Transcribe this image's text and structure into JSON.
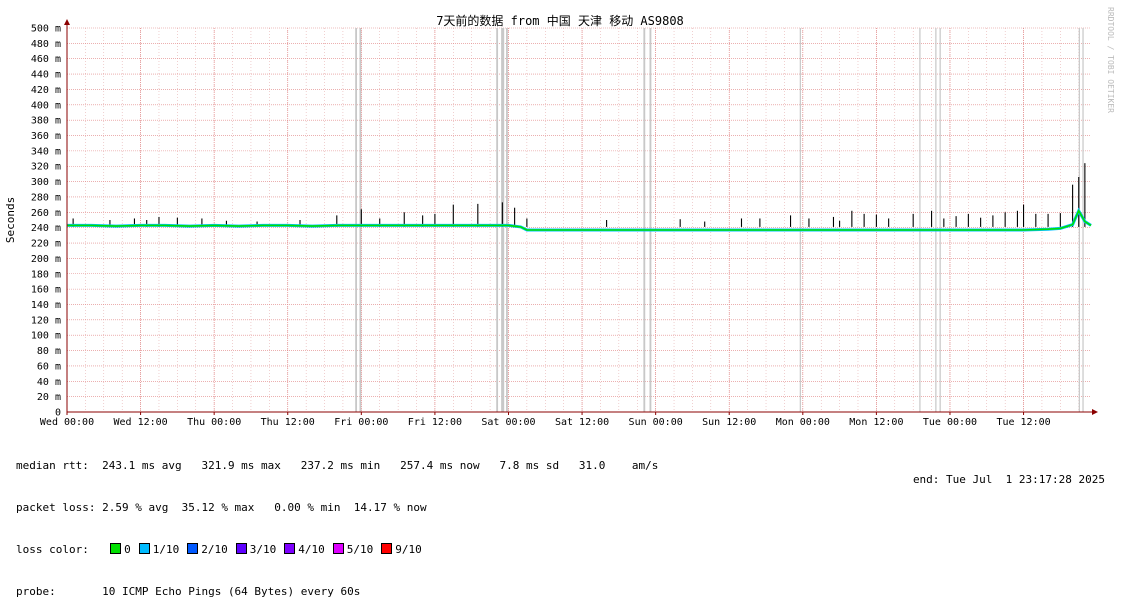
{
  "chart_data": {
    "type": "line",
    "title": "7天前的数据 from 中国 天津 移动 AS9808",
    "ylabel": "Seconds",
    "watermark": "RRDTOOL / TOBI OETIKER",
    "y_ticks": [
      "0",
      "20 m",
      "40 m",
      "60 m",
      "80 m",
      "100 m",
      "120 m",
      "140 m",
      "160 m",
      "180 m",
      "200 m",
      "220 m",
      "240 m",
      "260 m",
      "280 m",
      "300 m",
      "320 m",
      "340 m",
      "360 m",
      "380 m",
      "400 m",
      "420 m",
      "440 m",
      "460 m",
      "480 m",
      "500 m"
    ],
    "ylim_ms": [
      0,
      500
    ],
    "x_ticks": [
      "Wed 00:00",
      "Wed 12:00",
      "Thu 00:00",
      "Thu 12:00",
      "Fri 00:00",
      "Fri 12:00",
      "Sat 00:00",
      "Sat 12:00",
      "Sun 00:00",
      "Sun 12:00",
      "Mon 00:00",
      "Mon 12:00",
      "Tue 00:00",
      "Tue 12:00"
    ],
    "x_range_hours": [
      0,
      167
    ],
    "grid": true,
    "median_rtt_ms": [
      [
        0,
        243
      ],
      [
        4,
        243
      ],
      [
        8,
        242
      ],
      [
        12,
        243
      ],
      [
        16,
        243
      ],
      [
        20,
        242
      ],
      [
        24,
        243
      ],
      [
        28,
        242
      ],
      [
        32,
        243
      ],
      [
        36,
        243
      ],
      [
        40,
        242
      ],
      [
        44,
        243
      ],
      [
        48,
        243
      ],
      [
        52,
        243
      ],
      [
        56,
        243
      ],
      [
        60,
        243
      ],
      [
        64,
        243
      ],
      [
        68,
        243
      ],
      [
        72,
        243
      ],
      [
        74,
        241
      ],
      [
        75,
        237
      ],
      [
        80,
        237
      ],
      [
        84,
        237
      ],
      [
        88,
        237
      ],
      [
        92,
        237
      ],
      [
        96,
        237
      ],
      [
        100,
        237
      ],
      [
        104,
        237
      ],
      [
        108,
        237
      ],
      [
        112,
        237
      ],
      [
        116,
        237
      ],
      [
        120,
        237
      ],
      [
        124,
        237
      ],
      [
        128,
        237
      ],
      [
        132,
        237
      ],
      [
        136,
        237
      ],
      [
        140,
        237
      ],
      [
        144,
        237
      ],
      [
        148,
        237
      ],
      [
        152,
        237
      ],
      [
        156,
        237
      ],
      [
        160,
        238
      ],
      [
        162,
        239
      ],
      [
        164,
        244
      ],
      [
        165,
        262
      ],
      [
        166,
        248
      ],
      [
        167,
        243
      ]
    ],
    "spikes": [
      [
        1,
        252
      ],
      [
        7,
        250
      ],
      [
        11,
        252
      ],
      [
        13,
        250
      ],
      [
        15,
        254
      ],
      [
        18,
        253
      ],
      [
        22,
        252
      ],
      [
        26,
        249
      ],
      [
        31,
        248
      ],
      [
        38,
        250
      ],
      [
        44,
        256
      ],
      [
        48,
        264
      ],
      [
        51,
        252
      ],
      [
        55,
        260
      ],
      [
        58,
        256
      ],
      [
        60,
        258
      ],
      [
        63,
        270
      ],
      [
        67,
        271
      ],
      [
        71,
        273
      ],
      [
        73,
        266
      ],
      [
        75,
        252
      ],
      [
        88,
        250
      ],
      [
        100,
        251
      ],
      [
        104,
        248
      ],
      [
        110,
        252
      ],
      [
        113,
        252
      ],
      [
        118,
        256
      ],
      [
        121,
        252
      ],
      [
        125,
        254
      ],
      [
        126,
        249
      ],
      [
        128,
        262
      ],
      [
        130,
        258
      ],
      [
        132,
        257
      ],
      [
        134,
        252
      ],
      [
        138,
        258
      ],
      [
        141,
        262
      ],
      [
        143,
        252
      ],
      [
        145,
        255
      ],
      [
        147,
        258
      ],
      [
        149,
        253
      ],
      [
        151,
        256
      ],
      [
        153,
        260
      ],
      [
        155,
        262
      ],
      [
        156,
        270
      ],
      [
        158,
        258
      ],
      [
        160,
        258
      ],
      [
        162,
        259
      ],
      [
        164,
        296
      ],
      [
        165,
        306
      ],
      [
        166,
        324
      ]
    ],
    "loss_bands_hours": [
      [
        47.0,
        47.3
      ],
      [
        47.7,
        48.0
      ],
      [
        70.0,
        70.3
      ],
      [
        70.8,
        71.3
      ],
      [
        71.6,
        71.9
      ],
      [
        94.0,
        94.3
      ],
      [
        95.0,
        95.3
      ],
      [
        119.5,
        119.7
      ],
      [
        139.0,
        139.2
      ],
      [
        141.6,
        141.8
      ],
      [
        142.3,
        142.5
      ],
      [
        165.0,
        165.2
      ],
      [
        165.6,
        165.8
      ]
    ],
    "series_colors": {
      "line": "#000000",
      "low": "#00c0ff",
      "mid": "#0060ff",
      "main": "#00e000",
      "loss": "#c8c8c8",
      "grid_minor": "#e0a0a0",
      "axis": "#8b0000"
    }
  },
  "stats": {
    "median_label": "median rtt:",
    "median_values": "243.1 ms avg   321.9 ms max   237.2 ms min   257.4 ms now   7.8 ms sd   31.0    am/s",
    "loss_label": "packet loss:",
    "loss_values": "2.59 % avg  35.12 % max   0.00 % min  14.17 % now",
    "color_label": "loss color:",
    "loss_colors": [
      {
        "label": "0",
        "color": "#00e000"
      },
      {
        "label": "1/10",
        "color": "#00bbff"
      },
      {
        "label": "2/10",
        "color": "#0059ff"
      },
      {
        "label": "3/10",
        "color": "#5e00ff"
      },
      {
        "label": "4/10",
        "color": "#7e00ff"
      },
      {
        "label": "5/10",
        "color": "#dd00ff"
      },
      {
        "label": "9/10",
        "color": "#ff0000"
      }
    ],
    "probe_label": "probe:",
    "probe_value": "10 ICMP Echo Pings (64 Bytes) every 60s",
    "end_text": "end: Tue Jul  1 23:17:28 2025"
  }
}
